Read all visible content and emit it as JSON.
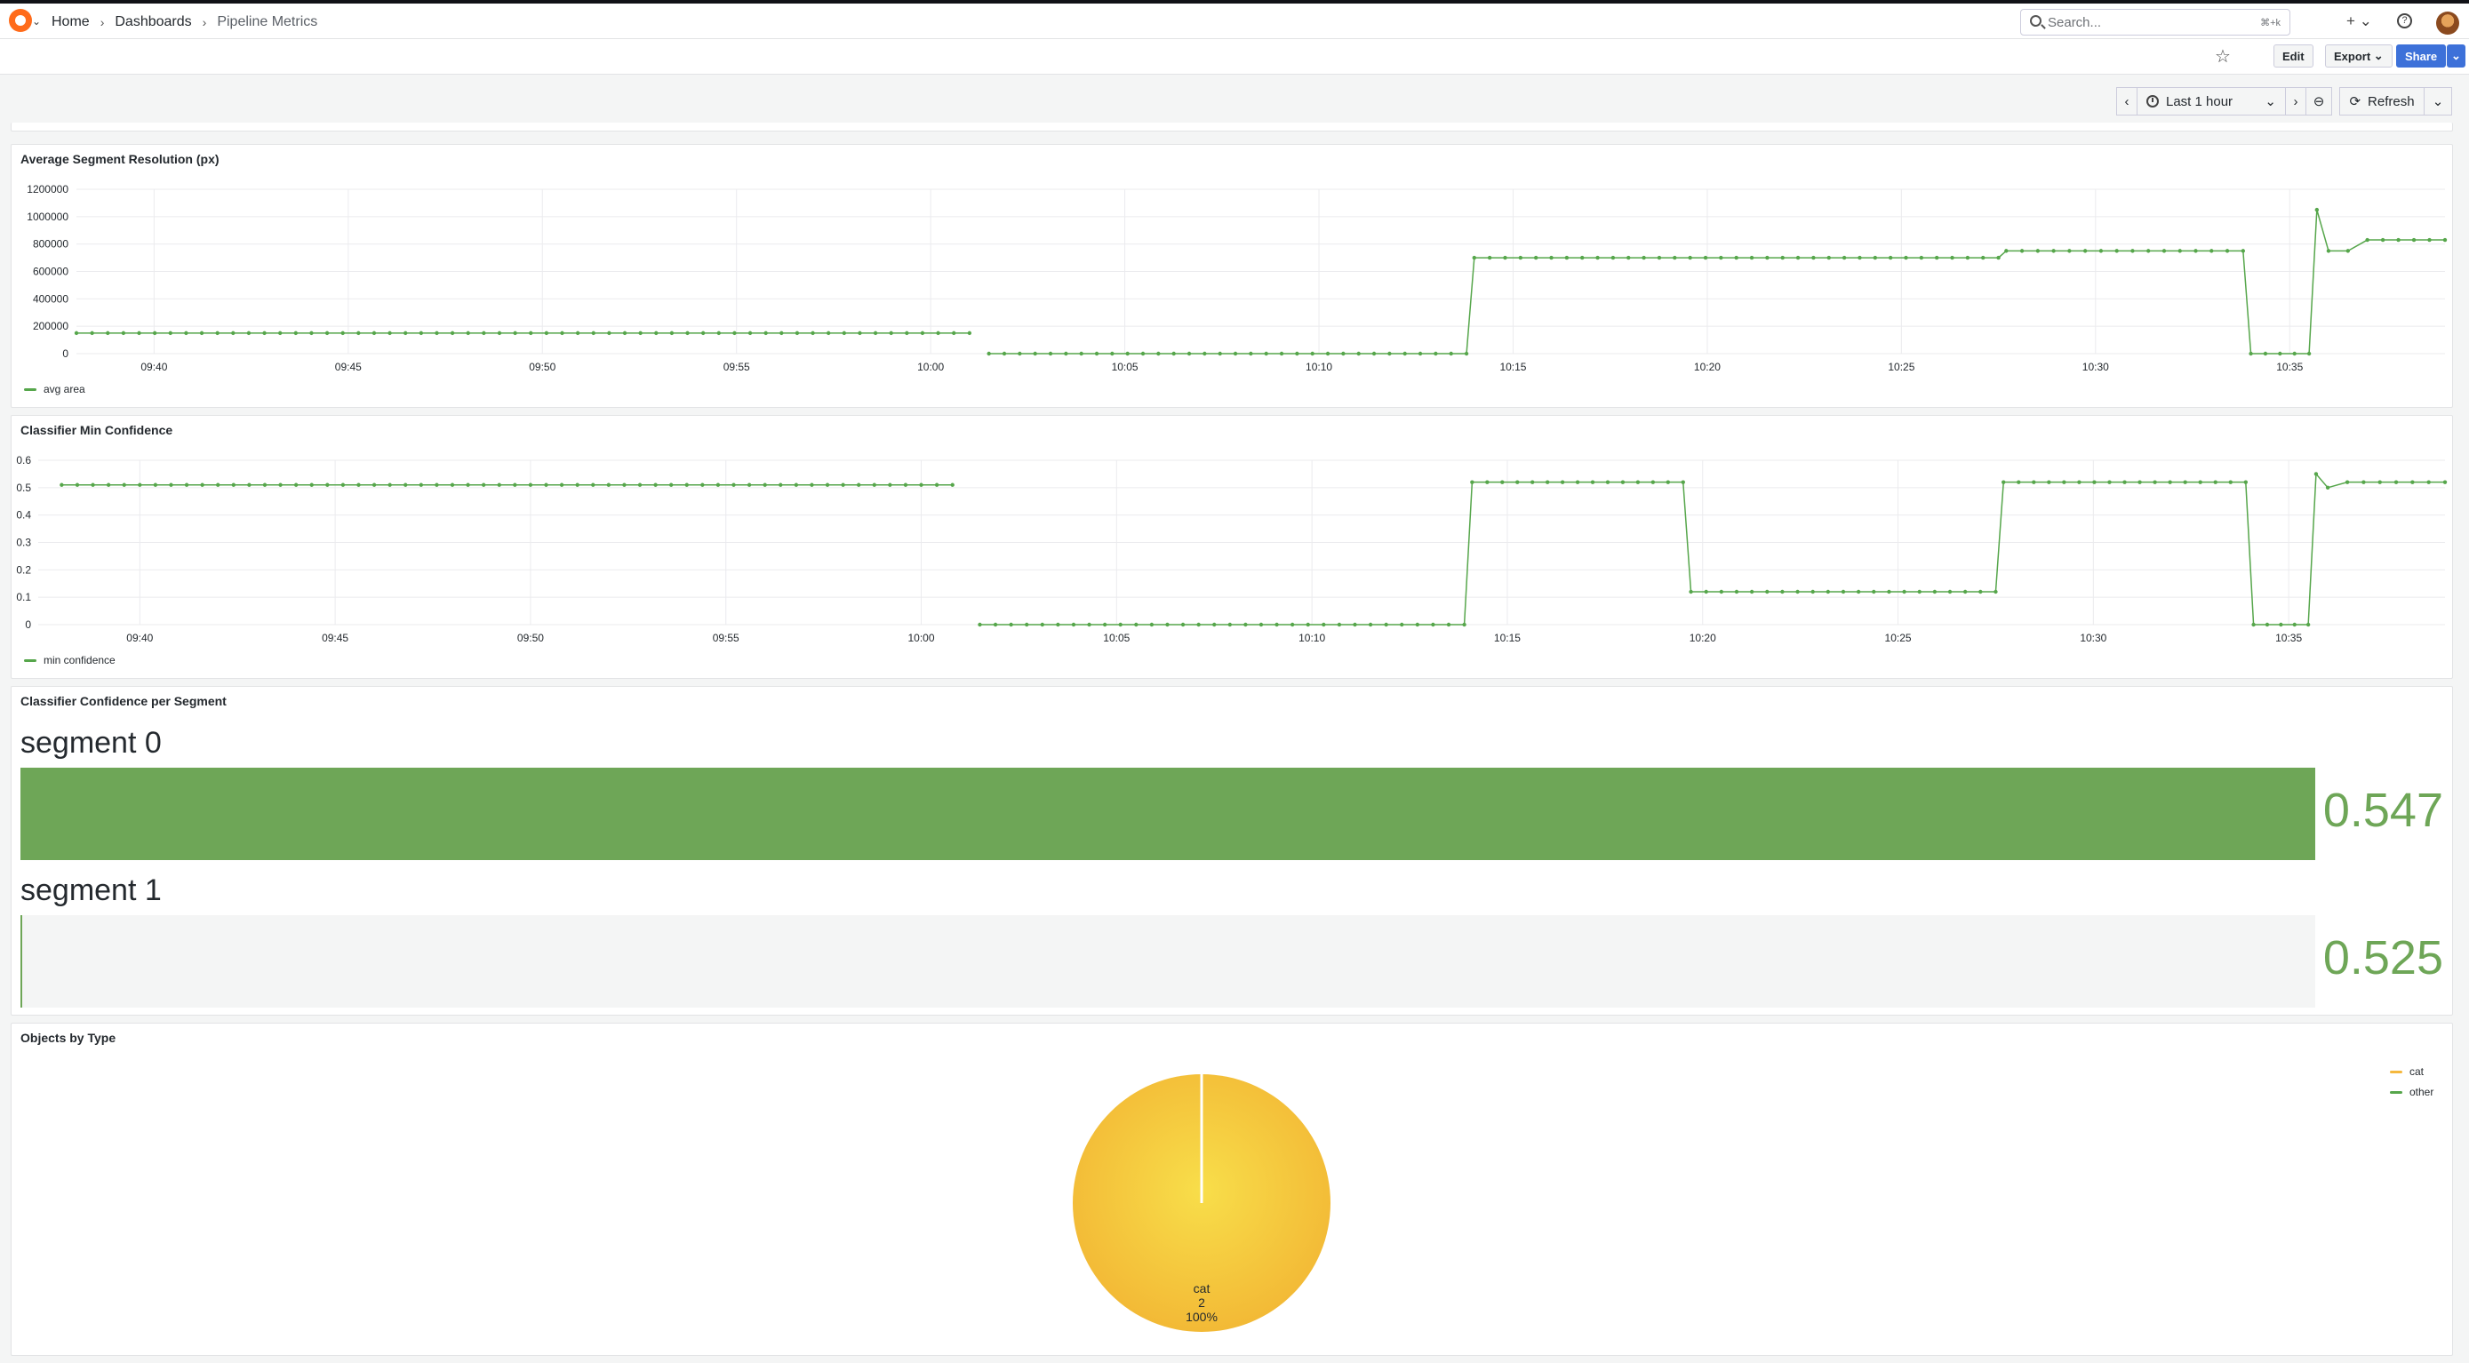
{
  "header": {
    "breadcrumbs": [
      "Home",
      "Dashboards",
      "Pipeline Metrics"
    ],
    "search_placeholder": "Search...",
    "search_shortcut": "⌘+k",
    "icons": [
      "grafana-logo-icon",
      "plus-icon",
      "help-icon",
      "avatar"
    ]
  },
  "toolbar": {
    "edit_label": "Edit",
    "export_label": "Export",
    "share_label": "Share"
  },
  "time": {
    "range_label": "Last 1 hour",
    "refresh_label": "Refresh"
  },
  "colors": {
    "series_green": "#56a64b",
    "bar_green": "#6ea657",
    "pie_cat": "#f5b83d",
    "pie_other": "#56a64b",
    "primary_blue": "#3d71d9"
  },
  "panels": {
    "resolution": {
      "title": "Average Segment Resolution (px)",
      "legend": "avg area"
    },
    "confidence": {
      "title": "Classifier Min Confidence",
      "legend": "min confidence"
    },
    "bargauge": {
      "title": "Classifier Confidence per Segment",
      "items": [
        {
          "label": "segment 0",
          "value": "0.547",
          "fill_fraction": 1.0
        },
        {
          "label": "segment 1",
          "value": "0.525",
          "fill_fraction": 0.0
        }
      ]
    },
    "pie": {
      "title": "Objects by Type",
      "legend": [
        "cat",
        "other"
      ],
      "slice_label": {
        "name": "cat",
        "count": "2",
        "percent": "100%"
      }
    }
  },
  "chart_data": [
    {
      "type": "line",
      "title": "Average Segment Resolution (px)",
      "ylim": [
        0,
        1200000
      ],
      "yticks": [
        "1200000",
        "1000000",
        "800000",
        "600000",
        "400000",
        "200000",
        "0"
      ],
      "xticks": [
        "09:40",
        "09:45",
        "09:50",
        "09:55",
        "10:00",
        "10:05",
        "10:10",
        "10:15",
        "10:20",
        "10:25",
        "10:30",
        "10:35"
      ],
      "grid": true,
      "legend_placement": "bottom-left",
      "series": [
        {
          "name": "avg area",
          "segments": [
            {
              "x": [
                "09:38",
                "10:01"
              ],
              "y": [
                150000,
                150000
              ]
            },
            {
              "x": [
                "10:01.5",
                "10:13.8",
                "10:14",
                "10:27.5",
                "10:27.7",
                "10:33.8",
                "10:34",
                "10:35.5",
                "10:35.7",
                "10:36",
                "10:36.5",
                "10:37",
                "10:39"
              ],
              "y": [
                0,
                0,
                700000,
                700000,
                750000,
                750000,
                0,
                0,
                1050000,
                750000,
                750000,
                830000,
                830000
              ]
            }
          ]
        }
      ]
    },
    {
      "type": "line",
      "title": "Classifier Min Confidence",
      "ylim": [
        0,
        0.6
      ],
      "yticks": [
        "0.6",
        "0.5",
        "0.4",
        "0.3",
        "0.2",
        "0.1",
        "0"
      ],
      "xticks": [
        "09:40",
        "09:45",
        "09:50",
        "09:55",
        "10:00",
        "10:05",
        "10:10",
        "10:15",
        "10:20",
        "10:25",
        "10:30",
        "10:35"
      ],
      "grid": true,
      "legend_placement": "bottom-left",
      "series": [
        {
          "name": "min confidence",
          "segments": [
            {
              "x": [
                "09:38",
                "10:00.8"
              ],
              "y": [
                0.51,
                0.51
              ]
            },
            {
              "x": [
                "10:01.5",
                "10:13.9",
                "10:14.1",
                "10:19.5",
                "10:19.7",
                "10:27.5",
                "10:27.7",
                "10:33.9",
                "10:34.1",
                "10:35.5",
                "10:35.7",
                "10:36",
                "10:36.5",
                "10:39"
              ],
              "y": [
                0,
                0,
                0.52,
                0.52,
                0.12,
                0.12,
                0.52,
                0.52,
                0,
                0,
                0.55,
                0.5,
                0.52,
                0.52
              ]
            }
          ]
        }
      ]
    },
    {
      "type": "bar",
      "title": "Classifier Confidence per Segment",
      "categories": [
        "segment 0",
        "segment 1"
      ],
      "values": [
        0.547,
        0.525
      ]
    },
    {
      "type": "pie",
      "title": "Objects by Type",
      "categories": [
        "cat",
        "other"
      ],
      "values": [
        2,
        0
      ],
      "legend_placement": "top-right"
    }
  ]
}
